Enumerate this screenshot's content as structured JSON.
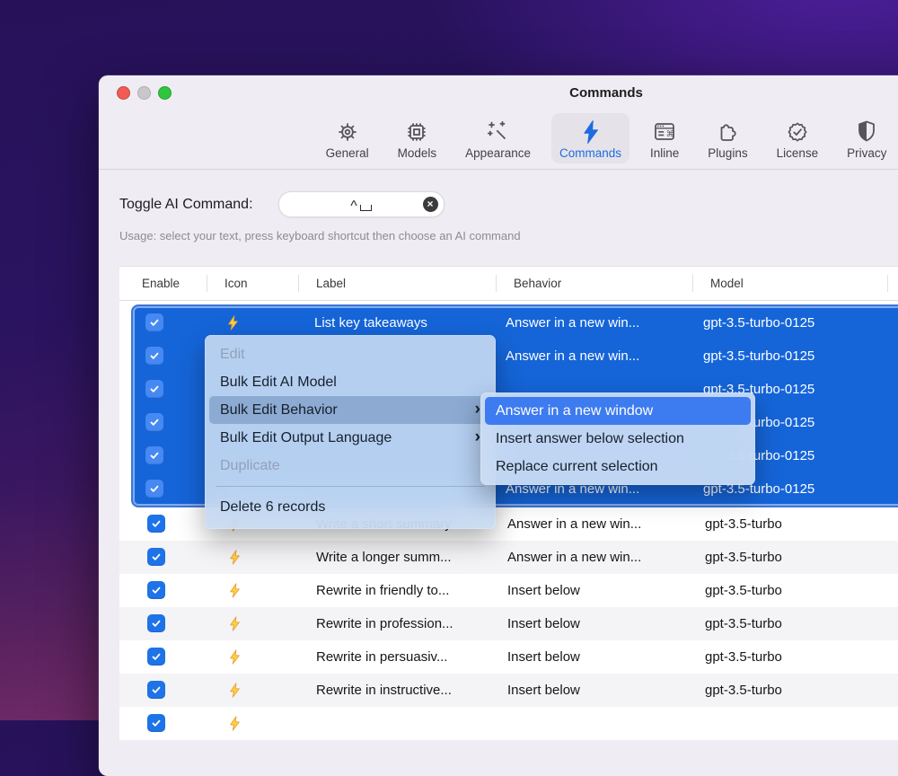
{
  "window": {
    "title": "Commands",
    "toolbar": {
      "tabs": [
        {
          "label": "General",
          "active": false
        },
        {
          "label": "Models",
          "active": false
        },
        {
          "label": "Appearance",
          "active": false
        },
        {
          "label": "Commands",
          "active": true
        },
        {
          "label": "Inline",
          "active": false
        },
        {
          "label": "Plugins",
          "active": false
        },
        {
          "label": "License",
          "active": false
        },
        {
          "label": "Privacy",
          "active": false
        }
      ]
    },
    "shortcut": {
      "label": "Toggle AI Command:",
      "modifier_key": "^",
      "key": "space",
      "clear_icon": "×",
      "usage": "Usage: select your text, press keyboard shortcut then choose an AI command"
    },
    "table": {
      "columns": [
        "Enable",
        "Icon",
        "Label",
        "Behavior",
        "Model"
      ],
      "selected_rows": [
        {
          "enabled": true,
          "icon": "lightning",
          "label": "List key takeaways",
          "behavior": "Answer in a new win...",
          "model": "gpt-3.5-turbo-0125"
        },
        {
          "enabled": true,
          "icon": "lightning",
          "label": "",
          "behavior": "Answer in a new win...",
          "model": "gpt-3.5-turbo-0125"
        },
        {
          "enabled": true,
          "icon": "lightning",
          "label": "",
          "behavior": "",
          "model": "gpt-3.5-turbo-0125"
        },
        {
          "enabled": true,
          "icon": "lightning",
          "label": "",
          "behavior": "",
          "model": "gpt-3.5-turbo-0125"
        },
        {
          "enabled": true,
          "icon": "lightning",
          "label": "",
          "behavior": "",
          "model": "gpt-3.5-turbo-0125"
        },
        {
          "enabled": true,
          "icon": "lightning",
          "label": "",
          "behavior": "Answer in a new win...",
          "model": "gpt-3.5-turbo-0125"
        }
      ],
      "rows": [
        {
          "enabled": true,
          "icon": "lightning",
          "label": "Write a short summary",
          "behavior": "Answer in a new win...",
          "model": "gpt-3.5-turbo"
        },
        {
          "enabled": true,
          "icon": "lightning",
          "label": "Write a longer summ...",
          "behavior": "Answer in a new win...",
          "model": "gpt-3.5-turbo"
        },
        {
          "enabled": true,
          "icon": "lightning",
          "label": "Rewrite in friendly to...",
          "behavior": "Insert below",
          "model": "gpt-3.5-turbo"
        },
        {
          "enabled": true,
          "icon": "lightning",
          "label": "Rewrite in profession...",
          "behavior": "Insert below",
          "model": "gpt-3.5-turbo"
        },
        {
          "enabled": true,
          "icon": "lightning",
          "label": "Rewrite in persuasiv...",
          "behavior": "Insert below",
          "model": "gpt-3.5-turbo"
        },
        {
          "enabled": true,
          "icon": "lightning",
          "label": "Rewrite in instructive...",
          "behavior": "Insert below",
          "model": "gpt-3.5-turbo"
        },
        {
          "enabled": true,
          "icon": "lightning",
          "label": "",
          "behavior": "",
          "model": ""
        }
      ]
    },
    "context_menu": {
      "submenu_chevron": "›",
      "items": [
        {
          "label": "Edit",
          "enabled": false
        },
        {
          "label": "Bulk Edit AI Model",
          "enabled": true
        },
        {
          "label": "Bulk Edit Behavior",
          "enabled": true,
          "highlighted": true,
          "has_submenu": true
        },
        {
          "label": "Bulk Edit Output Language",
          "enabled": true,
          "has_submenu": true
        },
        {
          "label": "Duplicate",
          "enabled": false
        },
        {
          "label": "Delete 6 records",
          "enabled": true
        }
      ]
    },
    "submenu": {
      "items": [
        {
          "label": "Answer in a new window",
          "highlighted": true
        },
        {
          "label": "Insert answer below selection",
          "highlighted": false
        },
        {
          "label": "Replace current selection",
          "highlighted": false
        }
      ]
    }
  },
  "colors": {
    "accent_blue": "#1f6ce0",
    "selection_blue": "#1565d9",
    "submenu_highlight_blue": "#3d7bf0",
    "bolt_yellow": "#ffd43a",
    "desktop_violet": "#4c1d96",
    "desktop_magenta": "#8a3372"
  }
}
